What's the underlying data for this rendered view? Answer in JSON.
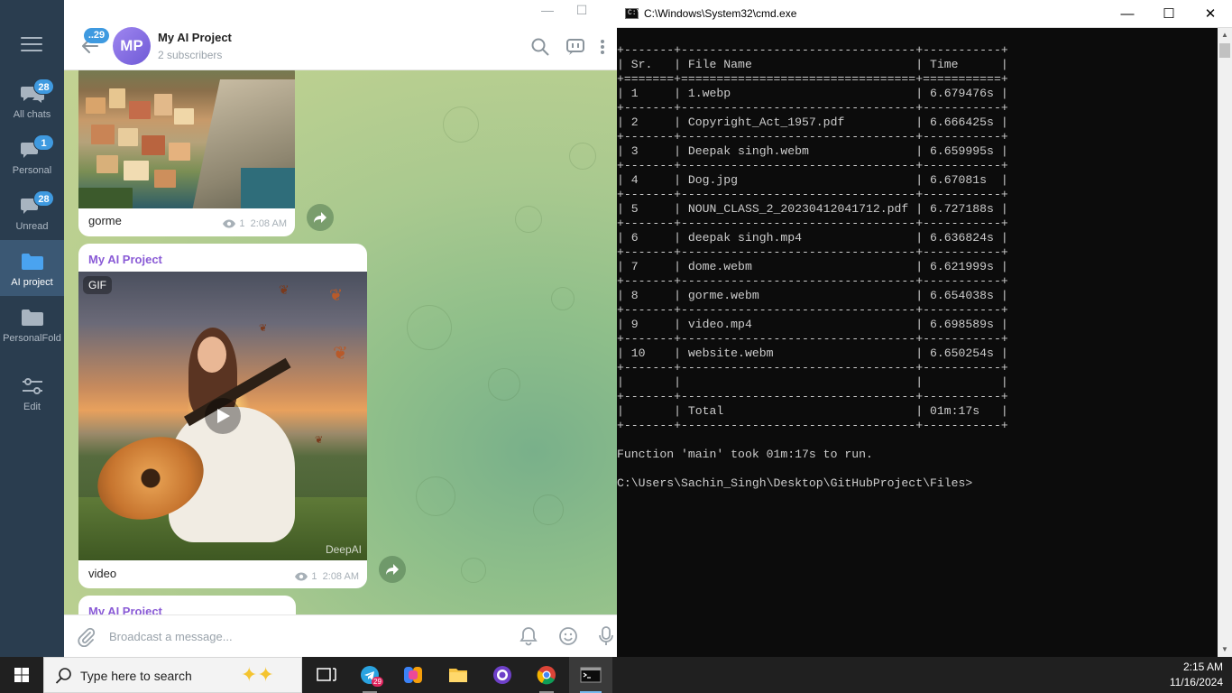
{
  "telegram": {
    "sidebar": {
      "items": [
        {
          "label": "All chats",
          "badge": "28",
          "icon": "chats-icon"
        },
        {
          "label": "Personal",
          "badge": "1",
          "icon": "folder-chat-icon"
        },
        {
          "label": "Unread",
          "badge": "28",
          "icon": "unread-icon"
        },
        {
          "label": "AI project",
          "badge": "",
          "icon": "folder-icon",
          "active": true
        },
        {
          "label": "PersonalFold",
          "badge": "",
          "icon": "folder-icon"
        },
        {
          "label": "Edit",
          "badge": "",
          "icon": "sliders-icon"
        }
      ]
    },
    "header": {
      "back_badge": "..29",
      "avatar_initials": "MP",
      "title": "My AI Project",
      "subtitle": "2 subscribers"
    },
    "messages": [
      {
        "caption": "gorme",
        "views": "1",
        "time": "2:08 AM"
      },
      {
        "sender": "My AI Project",
        "media_badge": "GIF",
        "watermark": "DeepAI",
        "caption": "video",
        "views": "1",
        "time": "2:08 AM"
      },
      {
        "sender": "My AI Project"
      }
    ],
    "input": {
      "placeholder": "Broadcast a message..."
    }
  },
  "cmd": {
    "title": "C:\\Windows\\System32\\cmd.exe",
    "table_rows": [
      {
        "sr": "1",
        "file": "1.webp",
        "time": "6.679476s"
      },
      {
        "sr": "2",
        "file": "Copyright_Act_1957.pdf",
        "time": "6.666425s"
      },
      {
        "sr": "3",
        "file": "Deepak singh.webm",
        "time": "6.659995s"
      },
      {
        "sr": "4",
        "file": "Dog.jpg",
        "time": "6.67081s"
      },
      {
        "sr": "5",
        "file": "NOUN_CLASS_2_20230412041712.pdf",
        "time": "6.727188s"
      },
      {
        "sr": "6",
        "file": "deepak singh.mp4",
        "time": "6.636824s"
      },
      {
        "sr": "7",
        "file": "dome.webm",
        "time": "6.621999s"
      },
      {
        "sr": "8",
        "file": "gorme.webm",
        "time": "6.654038s"
      },
      {
        "sr": "9",
        "file": "video.mp4",
        "time": "6.698589s"
      },
      {
        "sr": "10",
        "file": "website.webm",
        "time": "6.650254s"
      },
      {
        "sr": "",
        "file": "",
        "time": ""
      },
      {
        "sr": "",
        "file": "Total",
        "time": "01m:17s"
      }
    ],
    "headers": {
      "sr": "Sr.",
      "file": "File Name",
      "time": "Time"
    },
    "footer_line": "Function 'main' took 01m:17s to run.",
    "prompt": "C:\\Users\\Sachin_Singh\\Desktop\\GitHubProject\\Files>"
  },
  "taskbar": {
    "search_placeholder": "Type here to search",
    "telegram_badge": "29",
    "time": "2:15 AM",
    "date": "11/16/2024"
  },
  "colors": {
    "accent": "#3f9ae0",
    "sidebar": "#2a3d4f",
    "sender": "#8a5bd6"
  }
}
